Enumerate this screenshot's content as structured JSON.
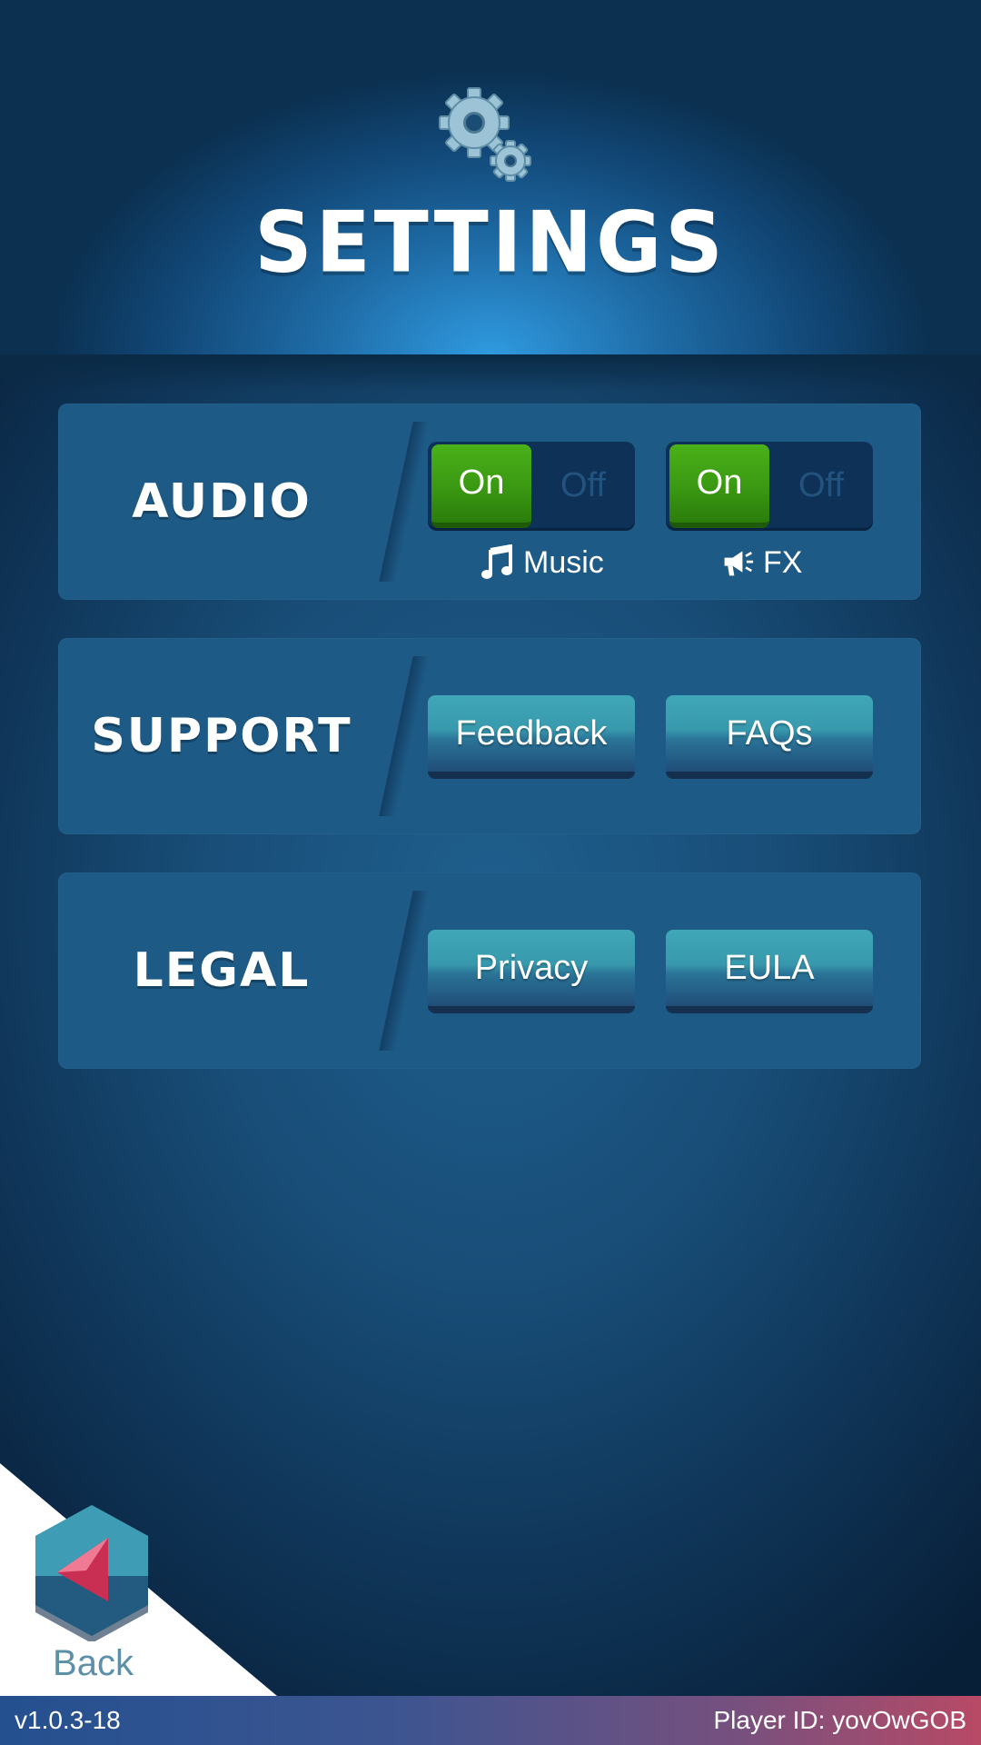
{
  "header": {
    "title": "SETTINGS",
    "icon": "gears-icon"
  },
  "audio": {
    "label": "AUDIO",
    "music": {
      "on_label": "On",
      "off_label": "Off",
      "state": "On",
      "caption": "Music",
      "icon": "music-note-icon"
    },
    "fx": {
      "on_label": "On",
      "off_label": "Off",
      "state": "On",
      "caption": "FX",
      "icon": "megaphone-icon"
    }
  },
  "support": {
    "label": "SUPPORT",
    "buttons": [
      "Feedback",
      "FAQs"
    ]
  },
  "legal": {
    "label": "LEGAL",
    "buttons": [
      "Privacy",
      "EULA"
    ]
  },
  "back": {
    "label": "Back",
    "icon": "back-arrow-icon"
  },
  "footer": {
    "version": "v1.0.3-18",
    "player_id": "Player ID: yovOwGOB"
  },
  "colors": {
    "toggle_on": "#3a9812",
    "button": "#3899ad",
    "background": "#184d77",
    "back_arrow": "#d83a5c"
  }
}
